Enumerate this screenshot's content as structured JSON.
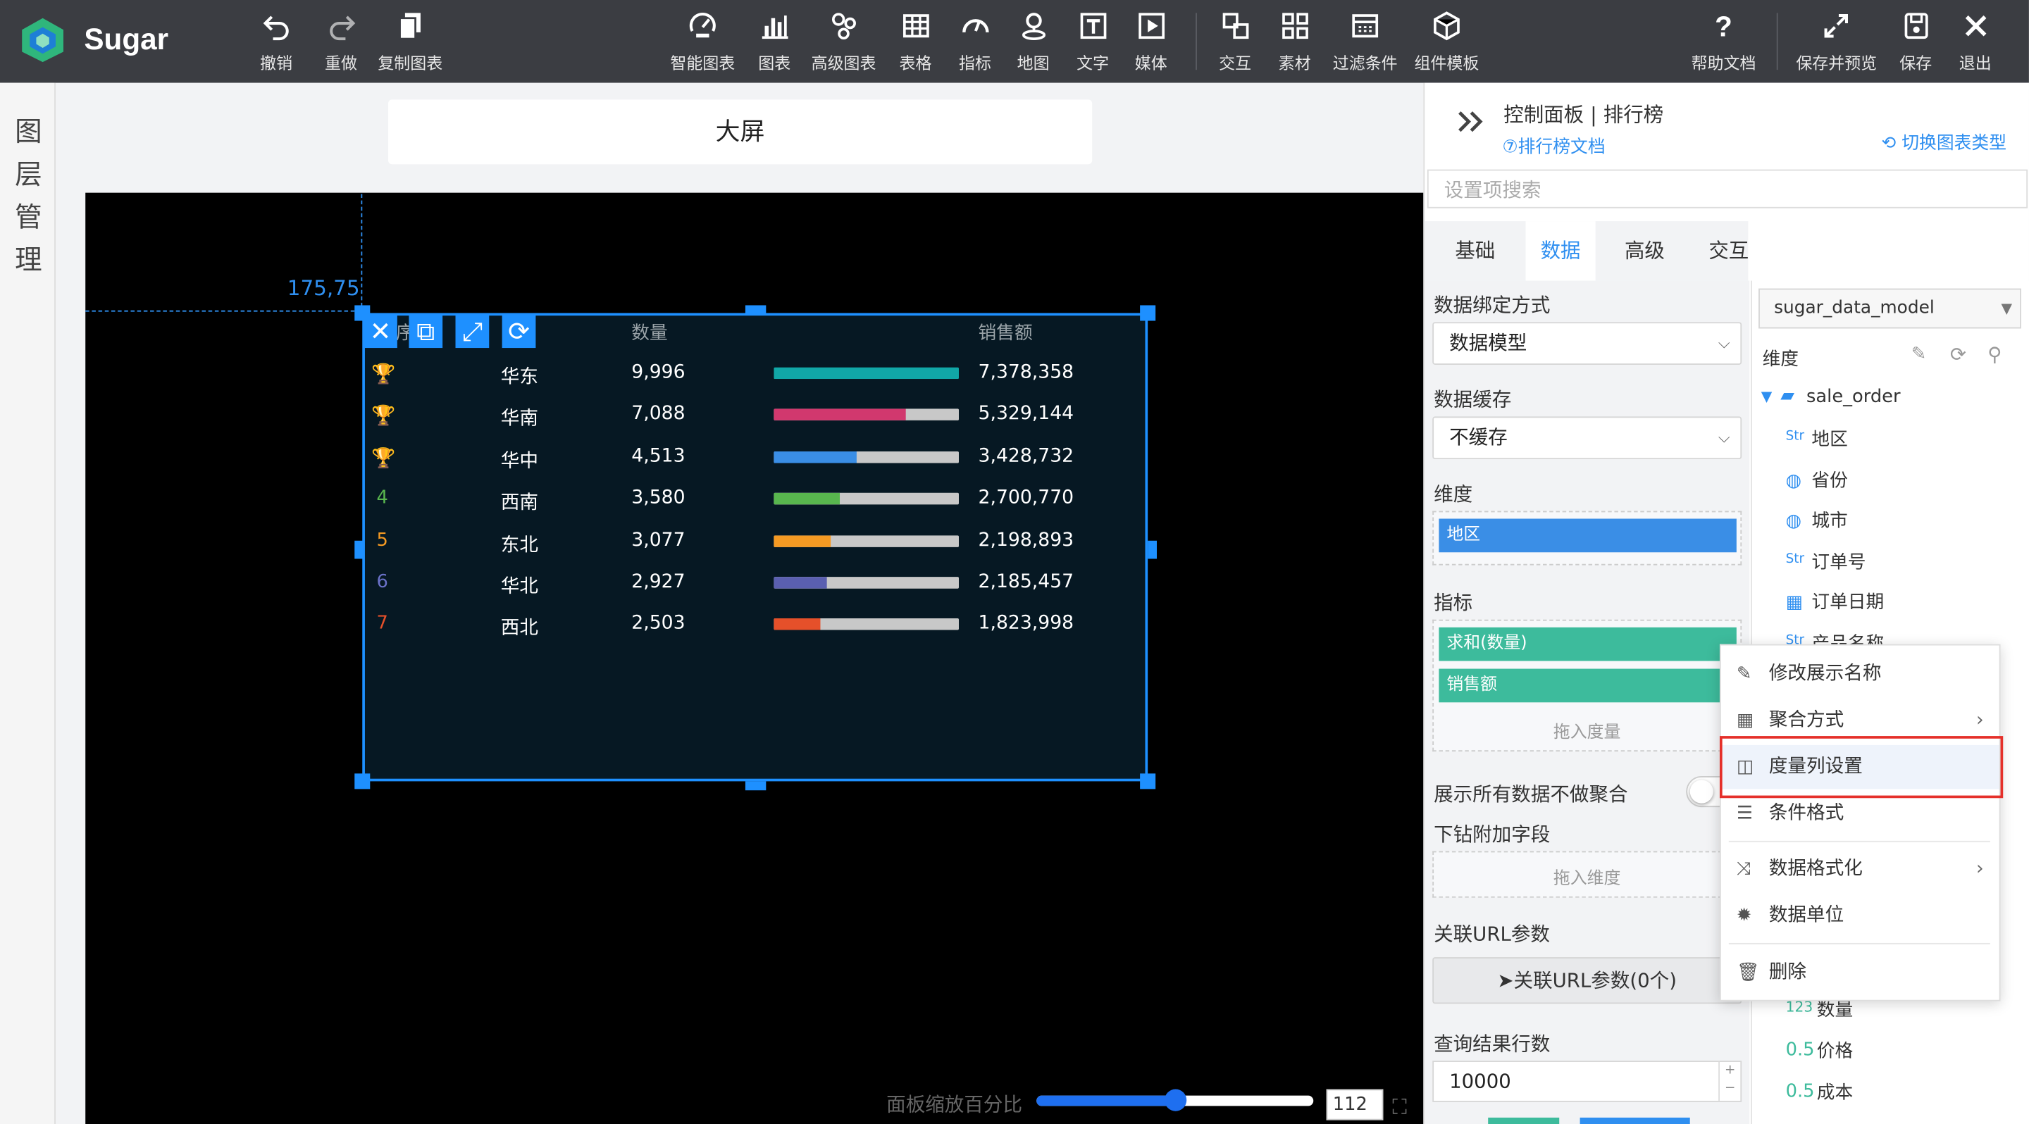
{
  "app": {
    "name": "Sugar"
  },
  "toolbar": {
    "left": [
      {
        "label": "撤销",
        "icon": "undo-icon"
      },
      {
        "label": "重做",
        "icon": "redo-icon"
      },
      {
        "label": "复制图表",
        "icon": "copy-chart-icon"
      }
    ],
    "center": [
      {
        "label": "智能图表",
        "icon": "smart-chart-icon"
      },
      {
        "label": "图表",
        "icon": "chart-icon"
      },
      {
        "label": "高级图表",
        "icon": "advanced-chart-icon"
      },
      {
        "label": "表格",
        "icon": "table-icon"
      },
      {
        "label": "指标",
        "icon": "gauge-icon"
      },
      {
        "label": "地图",
        "icon": "map-icon"
      },
      {
        "label": "文字",
        "icon": "text-icon"
      },
      {
        "label": "媒体",
        "icon": "media-icon"
      },
      {
        "label": "交互",
        "icon": "interaction-icon"
      },
      {
        "label": "素材",
        "icon": "material-icon"
      },
      {
        "label": "过滤条件",
        "icon": "filter-icon"
      },
      {
        "label": "组件模板",
        "icon": "component-template-icon"
      }
    ],
    "right": [
      {
        "label": "帮助文档",
        "icon": "help-icon"
      },
      {
        "label": "保存并预览",
        "icon": "save-preview-icon"
      },
      {
        "label": "保存",
        "icon": "save-icon"
      },
      {
        "label": "退出",
        "icon": "exit-icon"
      }
    ]
  },
  "sidebar": {
    "layer_label": [
      "图",
      "层",
      "管",
      "理"
    ]
  },
  "canvas": {
    "name": "大屏",
    "coord_readout": "175,75",
    "zoom_label": "面板缩放百分比",
    "zoom_value": "112",
    "zoom_fraction": 0.5
  },
  "ranking": {
    "headers": {
      "rank": "序号",
      "region": "",
      "qty": "数量",
      "bar": "",
      "sales": "销售额"
    },
    "rows": [
      {
        "rank": "1",
        "medal": "gold-trophy-icon",
        "region": "华东",
        "qty": "9,996",
        "sales": "7,378,358",
        "fill": 1.0,
        "color": "#11a7a7"
      },
      {
        "rank": "2",
        "medal": "silver-trophy-icon",
        "region": "华南",
        "qty": "7,088",
        "sales": "5,329,144",
        "fill": 0.71,
        "color": "#d1386e"
      },
      {
        "rank": "3",
        "medal": "bronze-trophy-icon",
        "region": "华中",
        "qty": "4,513",
        "sales": "3,428,732",
        "fill": 0.45,
        "color": "#3a8ee6"
      },
      {
        "rank": "4",
        "region": "西南",
        "qty": "3,580",
        "sales": "2,700,770",
        "fill": 0.36,
        "color": "#58b64e",
        "rank_color": "#58b64e"
      },
      {
        "rank": "5",
        "region": "东北",
        "qty": "3,077",
        "sales": "2,198,893",
        "fill": 0.31,
        "color": "#f59a23",
        "rank_color": "#f59a23"
      },
      {
        "rank": "6",
        "region": "华北",
        "qty": "2,927",
        "sales": "2,185,457",
        "fill": 0.29,
        "color": "#5a5fb0",
        "rank_color": "#6a71c8"
      },
      {
        "rank": "7",
        "region": "西北",
        "qty": "2,503",
        "sales": "1,823,998",
        "fill": 0.25,
        "color": "#e5502a",
        "rank_color": "#e5502a"
      }
    ]
  },
  "panel": {
    "title": "控制面板 | 排行榜",
    "doc_link": "⑦排行榜文档",
    "switch_type": "切换图表类型",
    "search_placeholder": "设置项搜索",
    "tabs": [
      "基础",
      "数据",
      "高级",
      "交互"
    ],
    "active_tab": "数据",
    "binding_label": "数据绑定方式",
    "binding_value": "数据模型",
    "cache_label": "数据缓存",
    "cache_value": "不缓存",
    "dimension_label": "维度",
    "dimension_pill": "地区",
    "measure_label": "指标",
    "measure_pills": [
      "求和(数量)",
      "销售额"
    ],
    "measure_drop": "拖入度量",
    "show_all_label": "展示所有数据不做聚合",
    "drill_label": "下钻附加字段",
    "drill_drop": "拖入维度",
    "url_label": "关联URL参数",
    "url_button": "关联URL参数(0个)",
    "rows_label": "查询结果行数",
    "rows_value": "10000"
  },
  "model": {
    "selected": "sugar_data_model",
    "dimension_header": "维度",
    "table": "sale_order",
    "fields": [
      {
        "type": "Str",
        "name": "地区"
      },
      {
        "type": "geo",
        "name": "省份"
      },
      {
        "type": "geo",
        "name": "城市"
      },
      {
        "type": "Str",
        "name": "订单号"
      },
      {
        "type": "date",
        "name": "订单日期"
      },
      {
        "type": "Str",
        "name": "产品名称"
      }
    ],
    "measures": [
      {
        "type": "123",
        "name": "数量"
      },
      {
        "type": "0.5",
        "name": "价格"
      },
      {
        "type": "0.5",
        "name": "成本"
      }
    ]
  },
  "context_menu": {
    "items": [
      {
        "label": "修改展示名称",
        "icon": "edit-icon"
      },
      {
        "label": "聚合方式",
        "icon": "calculator-icon",
        "submenu": true
      },
      {
        "label": "度量列设置",
        "icon": "column-settings-icon",
        "highlighted": true
      },
      {
        "label": "条件格式",
        "icon": "list-format-icon"
      },
      {
        "label": "数据格式化",
        "icon": "shuffle-icon",
        "submenu": true
      },
      {
        "label": "数据单位",
        "icon": "gear-icon"
      },
      {
        "label": "删除",
        "icon": "trash-icon"
      }
    ]
  },
  "colors": {
    "accent": "#2f8ff0",
    "topbar": "#3b3d42",
    "teal_pill": "#3dbb9c",
    "dim_pill": "#3a8ee6",
    "highlight_box": "#e5302a"
  }
}
